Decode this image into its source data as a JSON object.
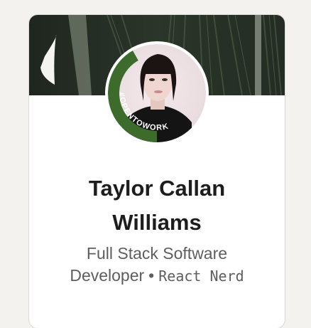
{
  "profile": {
    "name": "Taylor Callan Williams",
    "headline_main": "Full Stack Software Developer",
    "separator": "•",
    "headline_tag": "React Nerd",
    "open_to_work_badge": "#OPENTOWORK"
  },
  "colors": {
    "card_bg": "#ffffff",
    "page_bg": "#f3f2ef",
    "banner_leaf": "#2d3a2c",
    "open_to_work_green": "#3c6b2b",
    "name_text": "#1d1d1d",
    "headline_text": "#5e5e5e"
  }
}
